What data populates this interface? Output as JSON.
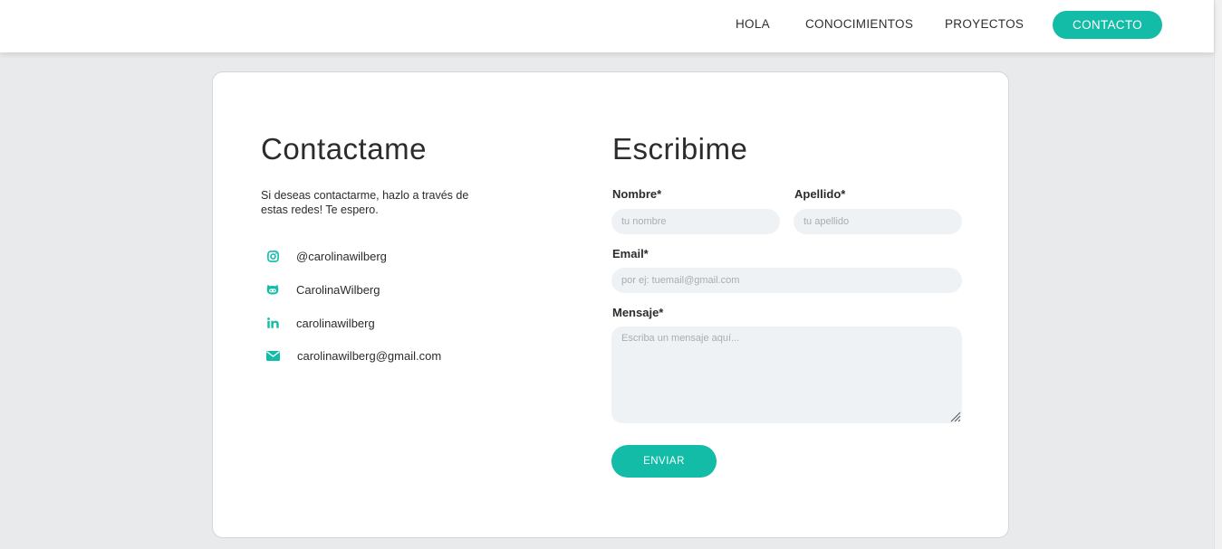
{
  "nav": {
    "hola": "HOLA",
    "conocimientos": "CONOCIMIENTOS",
    "proyectos": "PROYECTOS",
    "contacto": "CONTACTO"
  },
  "contact": {
    "title": "Contactame",
    "intro": "Si deseas contactarme, hazlo a través de estas redes! Te espero.",
    "socials": [
      {
        "icon": "instagram-icon",
        "label": "@carolinawilberg"
      },
      {
        "icon": "github-icon",
        "label": "CarolinaWilberg"
      },
      {
        "icon": "linkedin-icon",
        "label": "carolinawilberg"
      },
      {
        "icon": "mail-icon",
        "label": "carolinawilberg@gmail.com"
      }
    ]
  },
  "form": {
    "title": "Escribime",
    "nombre_label": "Nombre*",
    "nombre_placeholder": "tu nombre",
    "apellido_label": "Apellido*",
    "apellido_placeholder": "tu apellido",
    "email_label": "Email*",
    "email_placeholder": "por ej: tuemail@gmail.com",
    "mensaje_label": "Mensaje*",
    "mensaje_placeholder": "Escriba un mensaje aquí...",
    "submit_label": "ENVIAR"
  },
  "colors": {
    "accent": "#12bca7",
    "field_bg": "#eff2f5",
    "page_bg": "#e9eaec"
  }
}
